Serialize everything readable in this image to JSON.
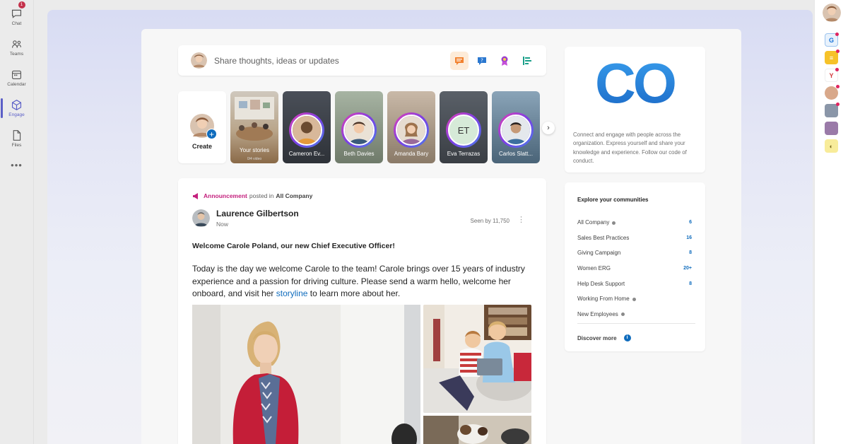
{
  "rail": {
    "items": [
      {
        "label": "Chat",
        "badge": "1"
      },
      {
        "label": "Teams"
      },
      {
        "label": "Calendar"
      },
      {
        "label": "Engage"
      },
      {
        "label": "Files"
      }
    ],
    "more": "•••"
  },
  "share": {
    "placeholder": "Share thoughts, ideas or updates"
  },
  "stories": {
    "create_label": "Create",
    "items": [
      {
        "name": "Your stories",
        "sub": "0/4 video"
      },
      {
        "name": "Cameron Ev..."
      },
      {
        "name": "Beth Davies"
      },
      {
        "name": "Amanda Bary"
      },
      {
        "name": "Eva Terrazas",
        "initials": "ET"
      },
      {
        "name": "Carlos Slatt..."
      }
    ],
    "next": "›"
  },
  "post": {
    "announcement_label": "Announcement",
    "posted_in": "posted in",
    "community": "All Company",
    "author": "Laurence Gilbertson",
    "time": "Now",
    "seen": "Seen by 11,750",
    "more": "⋮",
    "title": "Welcome Carole Poland, our new Chief Executive Officer!",
    "body_before_link": "Today is the day we welcome Carole to the team! Carole brings over 15 years of industry experience and a passion for driving culture. Please send a warm hello, welcome her onboard, and visit her ",
    "link_text": "storyline",
    "body_after_link": " to learn more about her."
  },
  "co_card": {
    "logo_text": "CO",
    "description": "Connect and engage with people across the organization. Express yourself and share your knowledge and experience. Follow our code of conduct."
  },
  "communities": {
    "heading": "Explore your communities",
    "items": [
      {
        "name": "All Company",
        "dot": true,
        "count": "6"
      },
      {
        "name": "Sales Best Practices",
        "count": "16"
      },
      {
        "name": "Giving Campaign",
        "count": "8"
      },
      {
        "name": "Women ERG",
        "count": "20+"
      },
      {
        "name": "Help Desk Support",
        "count": "8"
      },
      {
        "name": "Working From Home",
        "dot": true,
        "count": ""
      },
      {
        "name": "New Employees",
        "dot": true,
        "count": ""
      }
    ],
    "discover": "Discover more",
    "discover_icon": "i"
  },
  "colors": {
    "accent": "#5b5fc7",
    "brand_blue": "#0f6cbd",
    "announcement": "#c4217e"
  }
}
